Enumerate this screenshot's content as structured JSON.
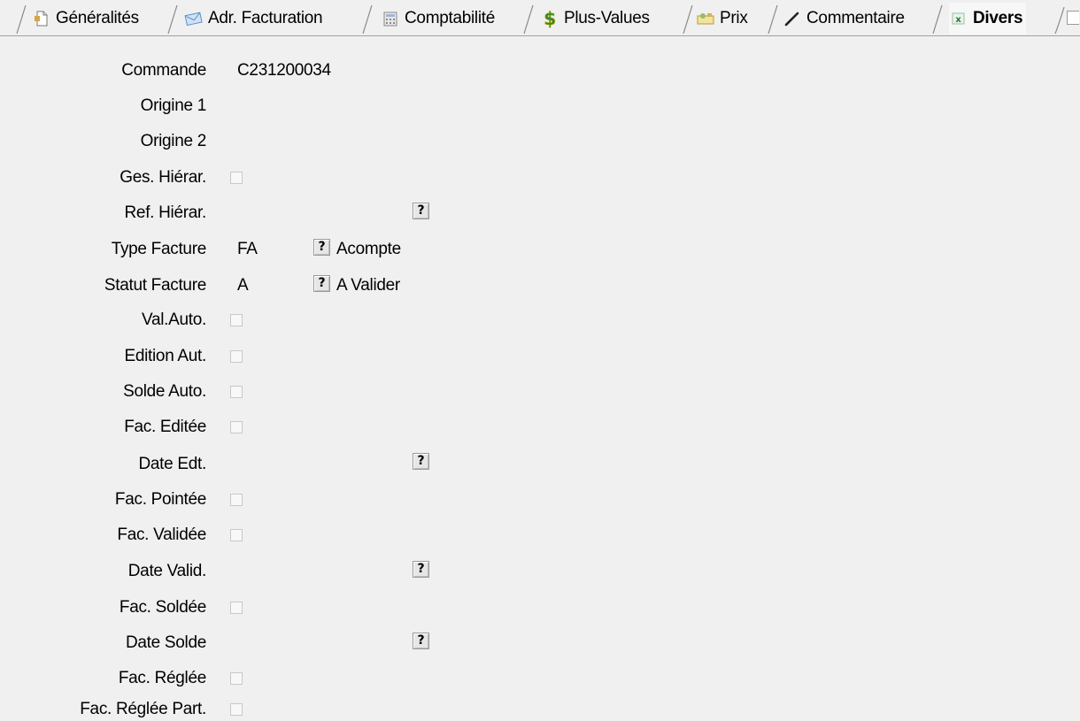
{
  "tabs": [
    {
      "label": "Généralités",
      "icon": "document-icon"
    },
    {
      "label": "Adr. Facturation",
      "icon": "envelope-icon"
    },
    {
      "label": "Comptabilité",
      "icon": "calculator-icon"
    },
    {
      "label": "Plus-Values",
      "icon": "dollar-icon"
    },
    {
      "label": "Prix",
      "icon": "price-tag-icon"
    },
    {
      "label": "Commentaire",
      "icon": "pen-icon"
    },
    {
      "label": "Divers",
      "icon": "excel-icon",
      "active": true
    }
  ],
  "form": {
    "commande": {
      "label": "Commande",
      "value": "C231200034"
    },
    "origine1": {
      "label": "Origine 1"
    },
    "origine2": {
      "label": "Origine 2"
    },
    "ges_hierar": {
      "label": "Ges. Hiérar.",
      "checked": false
    },
    "ref_hierar": {
      "label": "Ref. Hiérar.",
      "help": "?"
    },
    "type_facture": {
      "label": "Type Facture",
      "value": "FA",
      "help": "?",
      "description": "Acompte"
    },
    "statut_facture": {
      "label": "Statut Facture",
      "value": "A",
      "help": "?",
      "description": "A Valider"
    },
    "val_auto": {
      "label": "Val.Auto.",
      "checked": false
    },
    "edition_aut": {
      "label": "Edition Aut.",
      "checked": false
    },
    "solde_auto": {
      "label": "Solde Auto.",
      "checked": false
    },
    "fac_editee": {
      "label": "Fac. Editée",
      "checked": false
    },
    "date_edt": {
      "label": "Date Edt.",
      "help": "?"
    },
    "fac_pointee": {
      "label": "Fac. Pointée",
      "checked": false
    },
    "fac_validee": {
      "label": "Fac. Validée",
      "checked": false
    },
    "date_valid": {
      "label": "Date Valid.",
      "help": "?"
    },
    "fac_soldee": {
      "label": "Fac. Soldée",
      "checked": false
    },
    "date_solde": {
      "label": "Date Solde",
      "help": "?"
    },
    "fac_reglee": {
      "label": "Fac. Réglée",
      "checked": false
    },
    "fac_reglee_part": {
      "label": "Fac. Réglée Part.",
      "checked": false
    }
  },
  "colors": {
    "background": "#f0f0f0",
    "checkbox_border": "#c8c8c8",
    "excel_green": "#1f7a3a",
    "dollar_green": "#2e8b2e"
  }
}
